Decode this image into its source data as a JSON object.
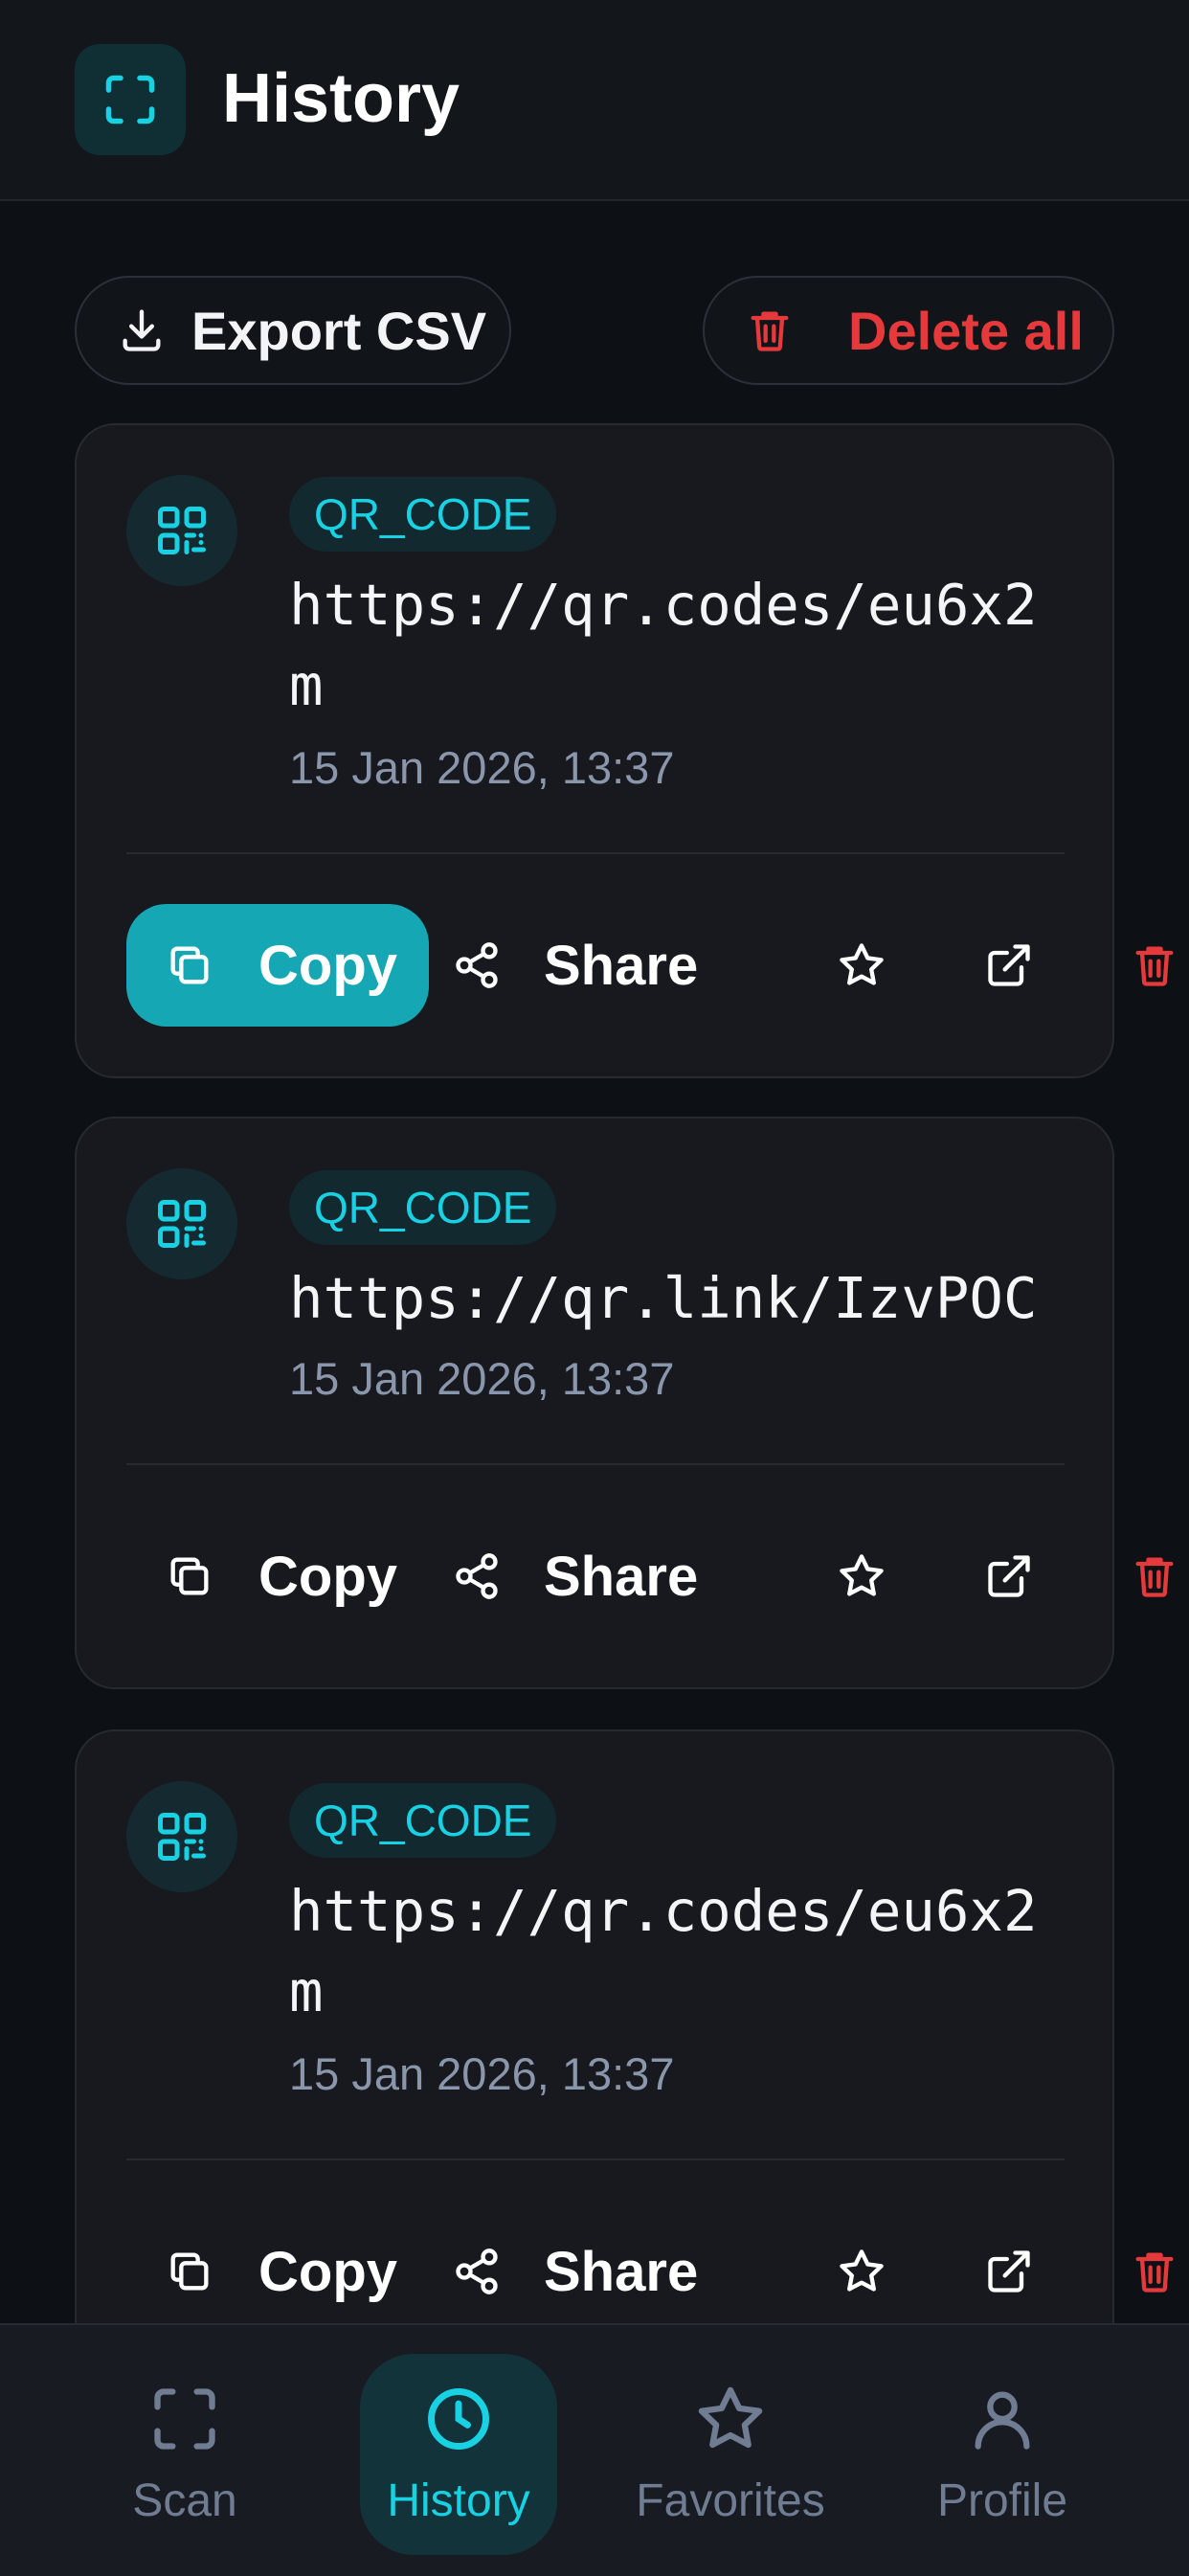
{
  "header": {
    "title": "History",
    "icon": "scan-frame-icon"
  },
  "toolbar": {
    "export_label": "Export CSV",
    "export_icon": "download-icon",
    "delete_all_label": "Delete all",
    "delete_all_icon": "trash-icon",
    "danger_color": "#e5393c"
  },
  "history": [
    {
      "type": "QR_CODE",
      "content": "https://qr.codes/eu6x2m",
      "timestamp": "15 Jan 2026, 13:37",
      "copy_active": true
    },
    {
      "type": "QR_CODE",
      "content": "https://qr.link/IzvPOC",
      "timestamp": "15 Jan 2026, 13:37",
      "copy_active": false
    },
    {
      "type": "QR_CODE",
      "content": "https://qr.codes/eu6x2m",
      "timestamp": "15 Jan 2026, 13:37",
      "copy_active": false
    }
  ],
  "actions": {
    "copy_label": "Copy",
    "share_label": "Share",
    "icons": [
      "copy-icon",
      "share-icon",
      "star-icon",
      "external-link-icon",
      "trash-icon"
    ]
  },
  "nav": {
    "items": [
      {
        "label": "Scan",
        "icon": "scan-frame-icon",
        "active": false
      },
      {
        "label": "History",
        "icon": "clock-icon",
        "active": true
      },
      {
        "label": "Favorites",
        "icon": "star-icon",
        "active": false
      },
      {
        "label": "Profile",
        "icon": "user-icon",
        "active": false
      }
    ]
  },
  "colors": {
    "accent": "#18d2e4",
    "accent_button": "#16a7b5",
    "background": "#0d1014",
    "card": "#17191e",
    "muted_text": "#8a96ab",
    "danger": "#e5393c"
  }
}
